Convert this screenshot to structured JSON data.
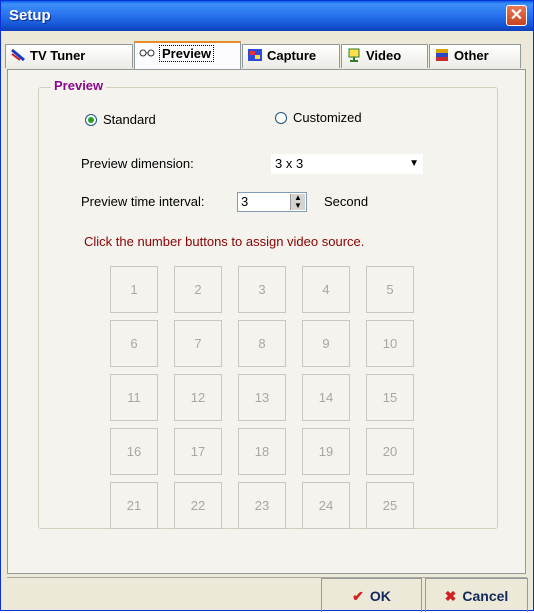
{
  "window": {
    "title": "Setup",
    "close_glyph": "✕"
  },
  "tabs": [
    {
      "label": "TV Tuner",
      "icon": "tv-tuner-icon"
    },
    {
      "label": "Preview",
      "icon": "glasses-icon",
      "active": true
    },
    {
      "label": "Capture",
      "icon": "capture-icon"
    },
    {
      "label": "Video",
      "icon": "video-icon"
    },
    {
      "label": "Other",
      "icon": "other-icon"
    }
  ],
  "preview": {
    "group_title": "Preview",
    "mode_options": [
      {
        "label": "Standard",
        "selected": true
      },
      {
        "label": "Customized",
        "selected": false
      }
    ],
    "dimension_label": "Preview dimension:",
    "dimension_value": "3 x 3",
    "interval_label": "Preview time interval:",
    "interval_value": "3",
    "interval_unit": "Second",
    "hint": "Click the number buttons to assign video source.",
    "grid_numbers": [
      "1",
      "2",
      "3",
      "4",
      "5",
      "6",
      "7",
      "8",
      "9",
      "10",
      "11",
      "12",
      "13",
      "14",
      "15",
      "16",
      "17",
      "18",
      "19",
      "20",
      "21",
      "22",
      "23",
      "24",
      "25"
    ]
  },
  "footer": {
    "ok_label": "OK",
    "cancel_label": "Cancel"
  },
  "colors": {
    "accent_tab": "#E68B2C",
    "group_title": "#8B0A8B",
    "hint": "#8B0000",
    "radio_on": "#21A121"
  }
}
